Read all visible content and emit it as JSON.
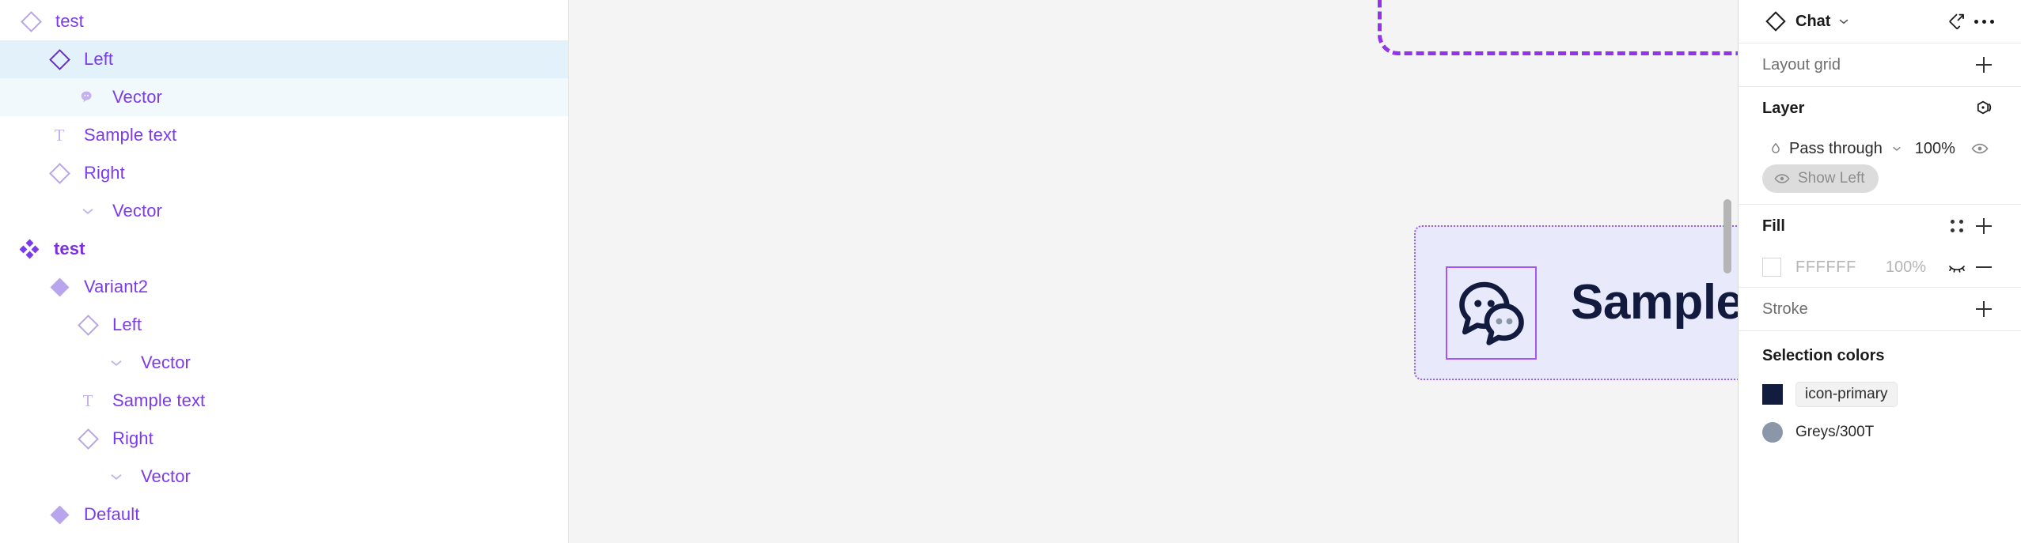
{
  "layers_panel": {
    "rows": [
      {
        "label": "test",
        "icon": "component-diamond-icon",
        "indent": 0,
        "state": "none",
        "bold": false
      },
      {
        "label": "Left",
        "icon": "component-diamond-icon",
        "indent": 1,
        "state": "sel-strong",
        "bold": false
      },
      {
        "label": "Vector",
        "icon": "chat-vector-icon",
        "indent": 2,
        "state": "sel-light",
        "bold": false
      },
      {
        "label": "Sample text",
        "icon": "text-icon",
        "indent": 1,
        "state": "none",
        "bold": false
      },
      {
        "label": "Right",
        "icon": "component-diamond-icon",
        "indent": 1,
        "state": "none",
        "bold": false
      },
      {
        "label": "Vector",
        "icon": "chevron-down-icon",
        "indent": 2,
        "state": "none",
        "bold": false
      },
      {
        "label": "test",
        "icon": "component-set-icon",
        "indent": -1,
        "state": "none",
        "bold": true
      },
      {
        "label": "Variant2",
        "icon": "variant-diamond-filled-icon",
        "indent": 0,
        "state": "none",
        "bold": false
      },
      {
        "label": "Left",
        "icon": "component-diamond-icon",
        "indent": 1,
        "state": "none",
        "bold": false
      },
      {
        "label": "Vector",
        "icon": "chevron-down-icon",
        "indent": 2,
        "state": "none",
        "bold": false
      },
      {
        "label": "Sample text",
        "icon": "text-icon",
        "indent": 1,
        "state": "none",
        "bold": false
      },
      {
        "label": "Right",
        "icon": "component-diamond-icon",
        "indent": 1,
        "state": "none",
        "bold": false
      },
      {
        "label": "Vector",
        "icon": "chevron-down-icon",
        "indent": 2,
        "state": "none",
        "bold": false
      },
      {
        "label": "Default",
        "icon": "variant-diamond-filled-icon",
        "indent": 0,
        "state": "none",
        "bold": false
      }
    ]
  },
  "canvas": {
    "component_label": "Sample text",
    "icon_name": "chat-bubbles-icon",
    "chevron_name": "chevron-down-icon",
    "component_fill": "#e8eafc",
    "component_set_border": "#9333ea",
    "text_color": "#121a3e"
  },
  "properties": {
    "header": {
      "title": "Chat",
      "type_icon": "component-diamond-icon",
      "dropdown_icon": "chevron-down-icon",
      "goto_main_icon": "go-to-main-component-icon",
      "more_icon": "more-options-icon"
    },
    "layout_grid": {
      "label": "Layout grid",
      "add_icon": "plus-icon"
    },
    "layer": {
      "label": "Layer",
      "styles_icon": "layer-style-icon",
      "blend_mode_icon": "blend-mode-icon",
      "blend_mode": "Pass through",
      "blend_dropdown_icon": "chevron-down-icon",
      "opacity": "100%",
      "visibility_icon": "eye-icon",
      "show_left_button": "Show Left",
      "show_left_icon": "eye-icon"
    },
    "fill": {
      "label": "Fill",
      "styles_icon": "four-dots-style-icon",
      "add_icon": "plus-icon",
      "items": [
        {
          "swatch_color": "#ffffff",
          "hex": "FFFFFF",
          "opacity": "100%",
          "visibility_icon": "eye-closed-icon",
          "remove_icon": "minus-icon"
        }
      ]
    },
    "stroke": {
      "label": "Stroke",
      "add_icon": "plus-icon"
    },
    "selection_colors": {
      "label": "Selection colors",
      "items": [
        {
          "name": "icon-primary",
          "color": "#111c3f",
          "shape": "square",
          "is_style": true
        },
        {
          "name": "Greys/300T",
          "color": "#8b96a8",
          "shape": "circle",
          "is_style": false
        }
      ]
    }
  }
}
